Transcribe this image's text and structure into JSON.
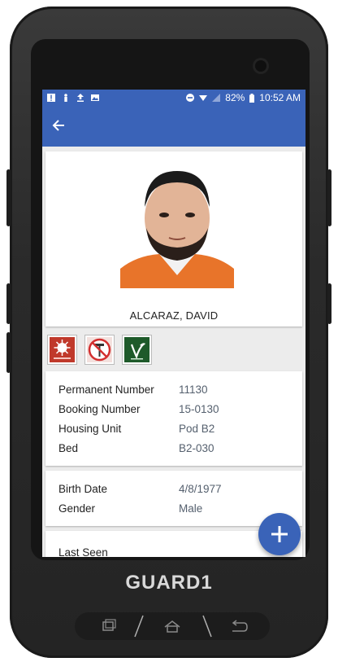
{
  "status_bar": {
    "battery": "82%",
    "time": "10:52 AM",
    "left_icons": [
      "alert-icon",
      "person-icon",
      "upload-icon",
      "image-icon"
    ],
    "right_icons": [
      "dnd-icon",
      "wifi-icon",
      "signal-icon",
      "battery-icon"
    ]
  },
  "app_bar": {
    "back_icon": "back-arrow-icon"
  },
  "inmate": {
    "name": "ALCARAZ, DAVID",
    "badges": [
      {
        "icon": "covid-precaution-icon",
        "color": "#c0392b"
      },
      {
        "icon": "no-razor-icon",
        "color": "#d32f2f"
      },
      {
        "icon": "vegan-icon",
        "color": "#1e5a2a"
      }
    ]
  },
  "identifiers": [
    {
      "label": "Permanent Number",
      "value": "11130"
    },
    {
      "label": "Booking Number",
      "value": "15-0130"
    },
    {
      "label": "Housing Unit",
      "value": "Pod B2"
    },
    {
      "label": "Bed",
      "value": "B2-030"
    }
  ],
  "personal": [
    {
      "label": "Birth Date",
      "value": "4/8/1977"
    },
    {
      "label": "Gender",
      "value": "Male"
    }
  ],
  "last_seen": {
    "label": "Last Seen"
  },
  "fab": {
    "label": "+"
  },
  "device": {
    "brand": "GUARD1"
  },
  "colors": {
    "accent": "#3a63b8",
    "value_text": "#55606e"
  }
}
